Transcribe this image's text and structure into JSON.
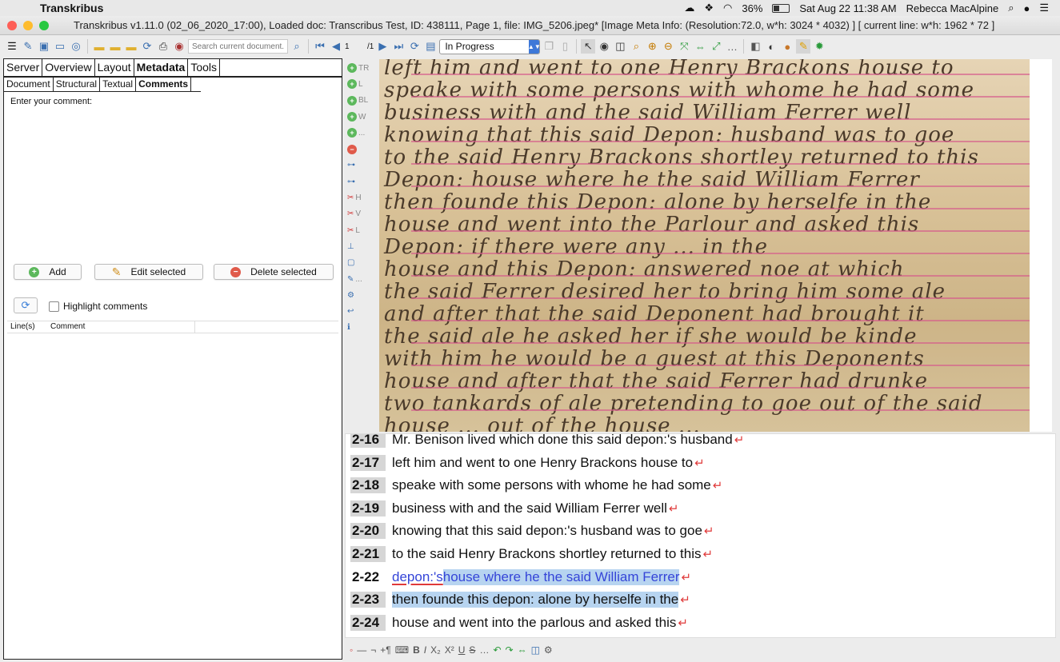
{
  "menubar": {
    "app": "Transkribus",
    "battery": "36%",
    "datetime": "Sat Aug 22  11:38 AM",
    "user": "Rebecca MacAlpine",
    "battery_level": 0.36
  },
  "window": {
    "title": "Transkribus v1.11.0 (02_06_2020_17:00), Loaded doc: Transcribus Test, ID: 438111, Page 1, file: IMG_5206.jpeg* [Image Meta Info: (Resolution:72.0, w*h: 3024 * 4032) ] [ current line: w*h: 1962 * 72 ]"
  },
  "toolbar": {
    "search_placeholder": "Search current document...",
    "page_num": "1",
    "page_total": "/1",
    "status": "In Progress"
  },
  "tabs": [
    "Server",
    "Overview",
    "Layout",
    "Metadata",
    "Tools"
  ],
  "subtabs": [
    "Document",
    "Structural",
    "Textual",
    "Comments"
  ],
  "comments": {
    "prompt": "Enter your comment:",
    "add": "Add",
    "edit": "Edit selected",
    "delete": "Delete selected",
    "highlight": "Highlight comments",
    "col_lines": "Line(s)",
    "col_comment": "Comment"
  },
  "vtools": [
    "TR",
    "L",
    "BL",
    "W",
    "...",
    "",
    "",
    "",
    "H",
    "V",
    "L",
    "",
    "",
    "...",
    "",
    "",
    ""
  ],
  "lines": [
    {
      "num": "2-16",
      "text": "Mr. Benison lived which done this said depon:'s husband"
    },
    {
      "num": "2-17",
      "text": "left him and went to one Henry Brackons house to"
    },
    {
      "num": "2-18",
      "text": "speake with some persons with whome he had some"
    },
    {
      "num": "2-19",
      "text": "business with and the said William Ferrer well"
    },
    {
      "num": "2-20",
      "text": "knowing that this said depon:'s husband was to goe"
    },
    {
      "num": "2-21",
      "text": "to the said Henry Brackons shortley returned to this"
    },
    {
      "num": "2-22",
      "pre": "depon:'s",
      "text": " house where he the said William Ferrer"
    },
    {
      "num": "2-23",
      "text": "then founde this depon: alone by herselfe in the"
    },
    {
      "num": "2-24",
      "text": "house and went into the parlous and asked this"
    }
  ],
  "manuscript": [
    "left him and went to one Henry Brackons house to",
    "speake with some persons with whome he had some",
    "business with and the said William Ferrer well",
    "knowing that this said Depon: husband was to goe",
    "to the said Henry Brackons shortley returned to this",
    "Depon: house where he the said William Ferrer",
    "then founde this Depon: alone by herselfe in the",
    "house and went into the Parlour and asked this",
    "Depon: if there were any ... in the",
    "house and this Depon: answered noe at which",
    "the said Ferrer desired her to bring him some ale",
    "and after that the said Deponent had brought it",
    "the said ale he asked her if she would be kinde",
    "with him he would be a guest at this Deponents",
    "house and after that the said Ferrer had drunke",
    "two tankards of ale pretending to goe out of the said",
    "house ... out of the house ..."
  ]
}
